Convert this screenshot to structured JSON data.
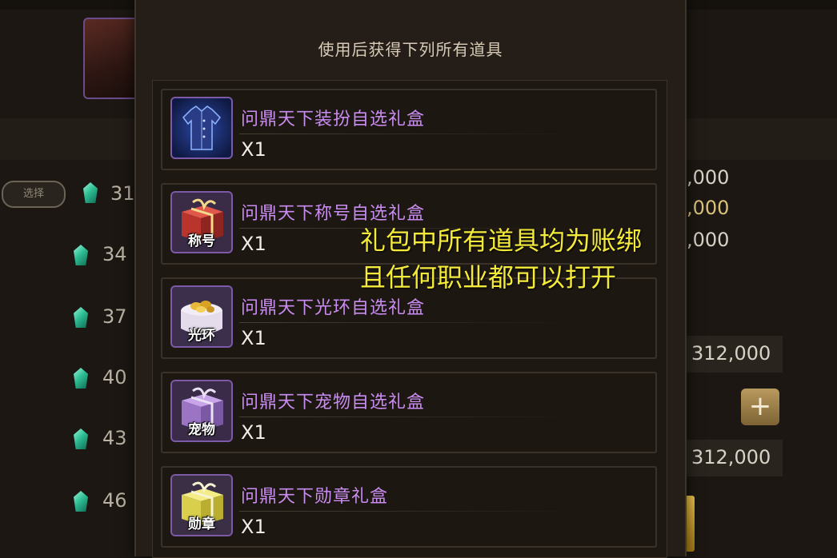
{
  "panel": {
    "title": "使用后获得下列所有道具",
    "items": [
      {
        "name": "问鼎天下装扮自选礼盒",
        "qty": "X1",
        "icon": "costume-shirt-icon",
        "badge": ""
      },
      {
        "name": "问鼎天下称号自选礼盒",
        "qty": "X1",
        "icon": "red-gift-box-icon",
        "badge": "称号"
      },
      {
        "name": "问鼎天下光环自选礼盒",
        "qty": "X1",
        "icon": "aura-cake-icon",
        "badge": "光环"
      },
      {
        "name": "问鼎天下宠物自选礼盒",
        "qty": "X1",
        "icon": "purple-gift-box-icon",
        "badge": "宠物"
      },
      {
        "name": "问鼎天下勋章礼盒",
        "qty": "X1",
        "icon": "yellow-gift-box-icon",
        "badge": "勋章"
      }
    ]
  },
  "overlay": {
    "line1": "礼包中所有道具均为账绑",
    "line2": "且任何职业都可以打开"
  },
  "background": {
    "tag_label": "选择",
    "left_values": [
      "31",
      "34",
      "37",
      "40",
      "43",
      "46"
    ],
    "right_values": [
      ",000",
      ",000",
      ",000",
      "312,000",
      "312,000"
    ],
    "plus_label": "+"
  },
  "colors": {
    "item_name": "#c98cf0",
    "overlay_text": "#f3ea3a",
    "gem": "#2fbf95"
  }
}
